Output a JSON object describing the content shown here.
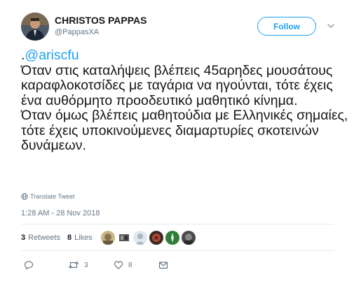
{
  "author": {
    "display_name": "CHRISTOS PAPPAS",
    "handle": "@PappasXA"
  },
  "follow_label": "Follow",
  "tweet": {
    "leading_dot": ".",
    "mention": "@ariscfu",
    "body": "Όταν στις καταλήψεις βλέπεις 45αρηδες μουσάτους καραφλοκοτσίδες με ταγάρια να ηγούνται, τότε έχεις ένα αυθόρμητο προοδευτικό μαθητικό κίνημα.\nΌταν όμως βλέπεις μαθητούδια με Ελληνικές σημαίες, τότε έχεις υποκινούμενες διαμαρτυρίες σκοτεινών δυνάμεων."
  },
  "translate_label": "Translate Tweet",
  "timestamp": "1:28 AM - 28 Nov 2018",
  "stats": {
    "retweets_count": "3",
    "retweets_label": "Retweets",
    "likes_count": "8",
    "likes_label": "Likes"
  },
  "actions": {
    "reply_icon": "reply-icon",
    "retweet_icon": "retweet-icon",
    "retweet_count": "3",
    "like_icon": "heart-icon",
    "like_count": "8",
    "dm_icon": "envelope-icon"
  },
  "colors": {
    "accent": "#1da1f2",
    "muted": "#657786",
    "text": "#14171a",
    "divider": "#e6ecf0"
  }
}
